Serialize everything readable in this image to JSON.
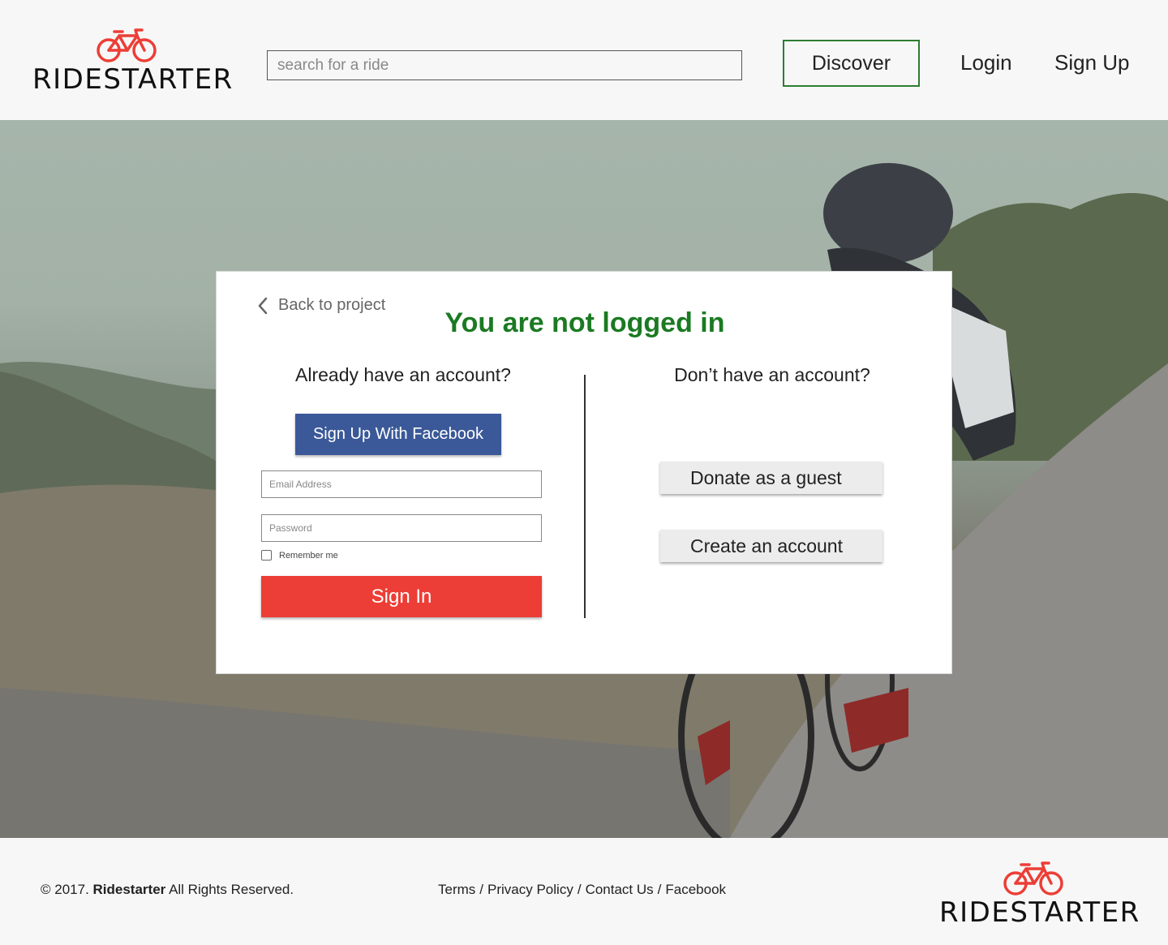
{
  "header": {
    "logo_text": "RIDESTARTER",
    "search_placeholder": "search for a ride",
    "discover_label": "Discover",
    "login_label": "Login",
    "signup_label": "Sign Up"
  },
  "card": {
    "back_label": "Back to project",
    "title": "You are not logged in",
    "left_heading": "Already have an account?",
    "right_heading": "Don’t have an account?",
    "facebook_label": "Sign Up With Facebook",
    "email_placeholder": "Email Address",
    "password_placeholder": "Password",
    "remember_label": "Remember me",
    "signin_label": "Sign In",
    "donate_label": "Donate as a guest",
    "create_label": "Create an account"
  },
  "footer": {
    "copyright_prefix": "© 2017. ",
    "brand": "Ridestarter",
    "copyright_suffix": " All Rights Reserved.",
    "links": [
      "Terms",
      "Privacy Policy",
      "Contact Us",
      "Facebook"
    ],
    "separator": "/",
    "logo_text": "RIDESTARTER"
  },
  "colors": {
    "brand_red": "#ec3e36",
    "title_green": "#1b7a22",
    "facebook_blue": "#3b5998",
    "discover_border": "#2e7d32"
  },
  "icons": {
    "logo": "bicycle-icon",
    "back": "chevron-left-icon"
  }
}
